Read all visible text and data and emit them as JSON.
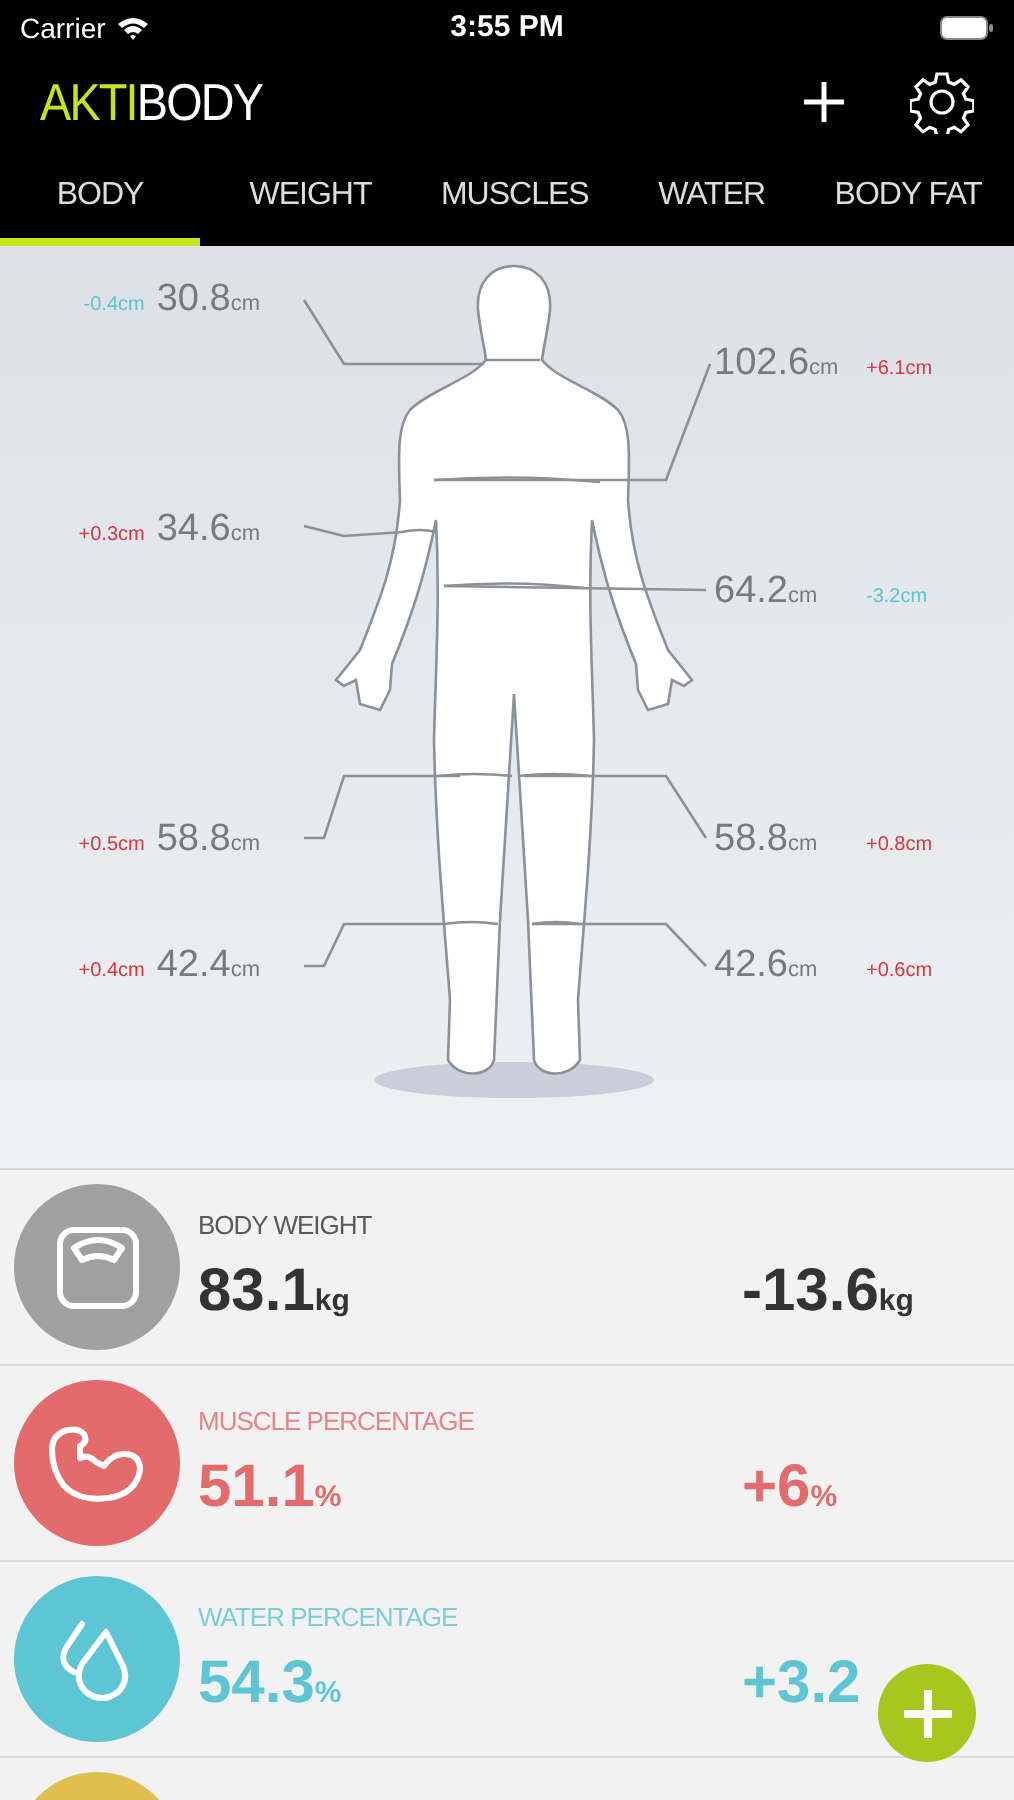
{
  "status_bar": {
    "carrier": "Carrier",
    "time": "3:55 PM"
  },
  "header": {
    "title_accent": "AKTI",
    "title_rest": "BODY"
  },
  "tabs": [
    {
      "label": "BODY",
      "selected": true
    },
    {
      "label": "WEIGHT",
      "selected": false
    },
    {
      "label": "MUSCLES",
      "selected": false
    },
    {
      "label": "WATER",
      "selected": false
    },
    {
      "label": "BODY FAT",
      "selected": false
    }
  ],
  "measurements": [
    {
      "kind": "left",
      "value": "30.8",
      "unit": "cm",
      "change": "-0.4cm",
      "color": "#5bc4d3"
    },
    {
      "kind": "right",
      "value": "102.6",
      "unit": "cm",
      "change": "+6.1cm",
      "color": "#d9363e"
    },
    {
      "kind": "left",
      "value": "34.6",
      "unit": "cm",
      "change": "+0.3cm",
      "color": "#d9363e"
    },
    {
      "kind": "right",
      "value": "64.2",
      "unit": "cm",
      "change": "-3.2cm",
      "color": "#5bc4d3"
    },
    {
      "kind": "left",
      "value": "58.8",
      "unit": "cm",
      "change": "+0.5cm",
      "color": "#d9363e"
    },
    {
      "kind": "right",
      "value": "58.8",
      "unit": "cm",
      "change": "+0.8cm",
      "color": "#d9363e"
    },
    {
      "kind": "left",
      "value": "42.4",
      "unit": "cm",
      "change": "+0.4cm",
      "color": "#d9363e"
    },
    {
      "kind": "right",
      "value": "42.6",
      "unit": "cm",
      "change": "+0.6cm",
      "color": "#d9363e"
    }
  ],
  "stats": [
    {
      "kind": "weight",
      "color": "#a0a0a0",
      "title": "BODY WEIGHT",
      "value": "83.1",
      "unit": "kg",
      "delta": "-13.6",
      "delta_unit": "kg"
    },
    {
      "kind": "muscle",
      "color": "#e36b6b",
      "title": "MUSCLE PERCENTAGE",
      "value": "51.1",
      "unit": "%",
      "delta": "+6",
      "delta_unit": "%"
    },
    {
      "kind": "water",
      "color": "#5ec5d4",
      "title": "WATER PERCENTAGE",
      "value": "54.3",
      "unit": "%",
      "delta": "+3.2"
    },
    {
      "kind": "other",
      "color": "#e0bf4e"
    }
  ]
}
